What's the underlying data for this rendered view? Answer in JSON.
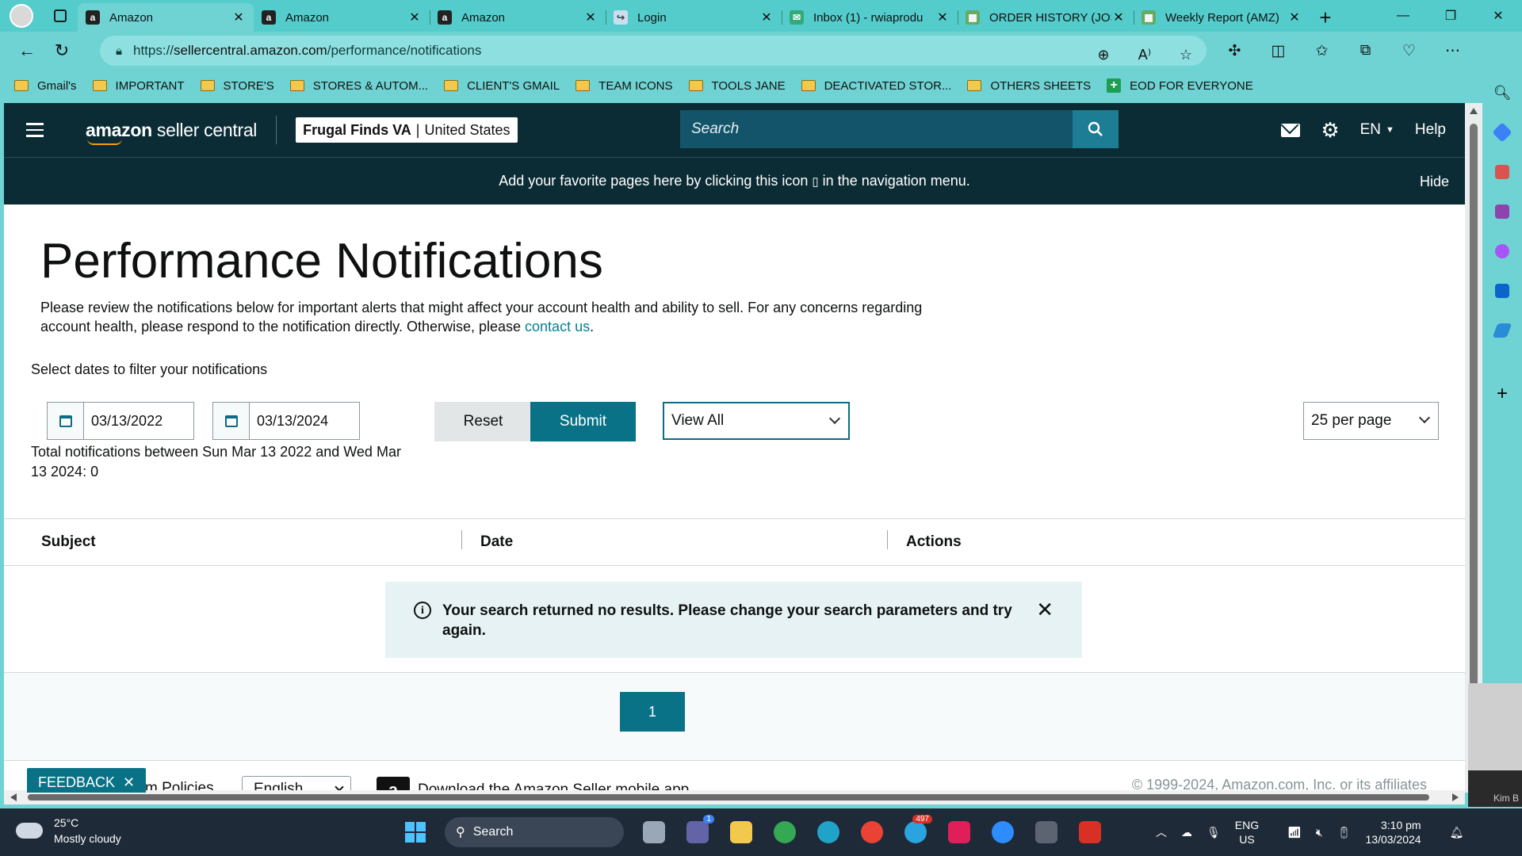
{
  "browser": {
    "tabs": [
      {
        "label": "Amazon",
        "fav": "amazon",
        "active": true
      },
      {
        "label": "Amazon",
        "fav": "amazon",
        "active": false
      },
      {
        "label": "Amazon",
        "fav": "amazon",
        "active": false
      },
      {
        "label": "Login",
        "fav": "login",
        "active": false
      },
      {
        "label": "Inbox (1) - rwiaprodu",
        "fav": "mail",
        "active": false
      },
      {
        "label": "ORDER HISTORY (JOS",
        "fav": "sheet",
        "active": false
      },
      {
        "label": "Weekly Report (AMZ)",
        "fav": "sheet",
        "active": false
      }
    ],
    "url_prefix": "https://",
    "url_host": "sellercentral.amazon.com",
    "url_path": "/performance/notifications",
    "bookmarks": [
      "Gmail's",
      "IMPORTANT",
      "STORE'S",
      "STORES & AUTOM...",
      "CLIENT'S GMAIL",
      "TEAM ICONS",
      "TOOLS JANE",
      "DEACTIVATED STOR...",
      "OTHERS SHEETS"
    ],
    "bookmark_special": "EOD FOR EVERYONE"
  },
  "header": {
    "logo_bold": "amazon",
    "logo_rest": " seller central",
    "account_name": "Frugal Finds VA",
    "account_region": "United States",
    "search_placeholder": "Search",
    "lang": "EN",
    "help": "Help"
  },
  "fav_banner": {
    "text_before": "Add your favorite pages here by clicking this icon",
    "text_after": "in the navigation menu.",
    "hide": "Hide"
  },
  "page": {
    "title": "Performance Notifications",
    "desc": "Please review the notifications below for important alerts that might affect your account health and ability to sell. For any concerns regarding account health, please respond to the notification directly. Otherwise, please ",
    "desc_link": "contact us",
    "desc_end": ".",
    "filter_label": "Select dates to filter your notifications",
    "start_date": "03/13/2022",
    "end_date": "03/13/2024",
    "reset": "Reset",
    "submit": "Submit",
    "view_filter": "View All",
    "per_page": "25 per page",
    "totals": "Total notifications between Sun Mar 13 2022 and Wed Mar 13 2024: 0"
  },
  "table": {
    "col_subject": "Subject",
    "col_date": "Date",
    "col_actions": "Actions",
    "empty_message": "Your search returned no results. Please change your search parameters and try again."
  },
  "pagination": {
    "current": "1"
  },
  "footer": {
    "feedback": "FEEDBACK",
    "policies": "m Policies",
    "language": "English",
    "app_download": "Download the Amazon Seller mobile app",
    "copyright": "© 1999-2024, Amazon.com, Inc. or its affiliates"
  },
  "pip_label": "Kim B",
  "taskbar": {
    "temp": "25°C",
    "weather": "Mostly cloudy",
    "search": "Search",
    "lang1": "ENG",
    "lang2": "US",
    "time": "3:10 pm",
    "date": "13/03/2024",
    "teams_badge": "1",
    "telegram_badge": "497"
  }
}
